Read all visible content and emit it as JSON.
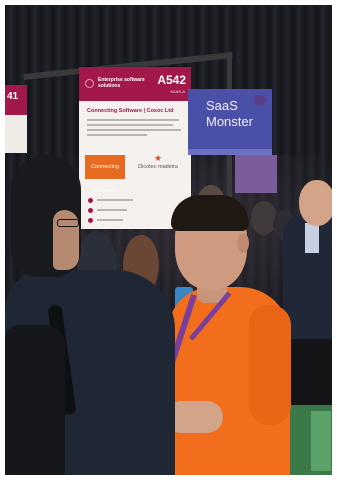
{
  "scene": {
    "description": "",
    "main_sign": {
      "category": "Enterprise software solutions",
      "booth": "A542",
      "booth_sub": "SAAS-A",
      "company": "Connecting Software | Cosoc Ltd",
      "logo_left": "Connecting Software",
      "logo_right": "Dicotec madeira"
    },
    "left_sign": {
      "booth": "41"
    },
    "saas_sign": {
      "line1": "SaaS",
      "line2": "Monster"
    }
  }
}
